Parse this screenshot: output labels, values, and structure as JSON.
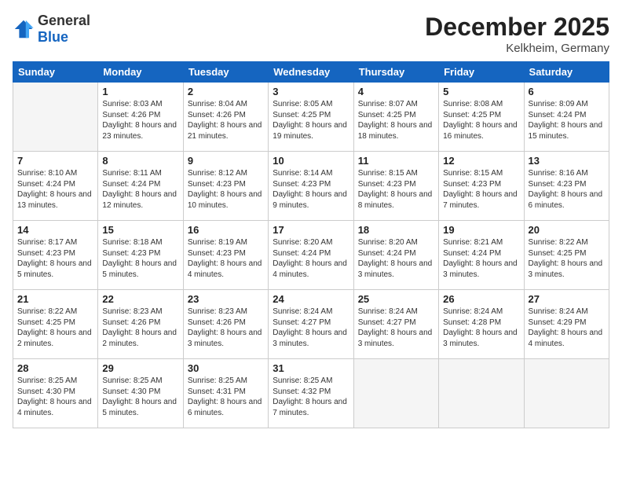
{
  "header": {
    "logo_general": "General",
    "logo_blue": "Blue",
    "month_title": "December 2025",
    "location": "Kelkheim, Germany"
  },
  "weekdays": [
    "Sunday",
    "Monday",
    "Tuesday",
    "Wednesday",
    "Thursday",
    "Friday",
    "Saturday"
  ],
  "weeks": [
    [
      {
        "day": "",
        "empty": true
      },
      {
        "day": "1",
        "sunrise": "Sunrise: 8:03 AM",
        "sunset": "Sunset: 4:26 PM",
        "daylight": "Daylight: 8 hours and 23 minutes."
      },
      {
        "day": "2",
        "sunrise": "Sunrise: 8:04 AM",
        "sunset": "Sunset: 4:26 PM",
        "daylight": "Daylight: 8 hours and 21 minutes."
      },
      {
        "day": "3",
        "sunrise": "Sunrise: 8:05 AM",
        "sunset": "Sunset: 4:25 PM",
        "daylight": "Daylight: 8 hours and 19 minutes."
      },
      {
        "day": "4",
        "sunrise": "Sunrise: 8:07 AM",
        "sunset": "Sunset: 4:25 PM",
        "daylight": "Daylight: 8 hours and 18 minutes."
      },
      {
        "day": "5",
        "sunrise": "Sunrise: 8:08 AM",
        "sunset": "Sunset: 4:25 PM",
        "daylight": "Daylight: 8 hours and 16 minutes."
      },
      {
        "day": "6",
        "sunrise": "Sunrise: 8:09 AM",
        "sunset": "Sunset: 4:24 PM",
        "daylight": "Daylight: 8 hours and 15 minutes."
      }
    ],
    [
      {
        "day": "7",
        "sunrise": "Sunrise: 8:10 AM",
        "sunset": "Sunset: 4:24 PM",
        "daylight": "Daylight: 8 hours and 13 minutes."
      },
      {
        "day": "8",
        "sunrise": "Sunrise: 8:11 AM",
        "sunset": "Sunset: 4:24 PM",
        "daylight": "Daylight: 8 hours and 12 minutes."
      },
      {
        "day": "9",
        "sunrise": "Sunrise: 8:12 AM",
        "sunset": "Sunset: 4:23 PM",
        "daylight": "Daylight: 8 hours and 10 minutes."
      },
      {
        "day": "10",
        "sunrise": "Sunrise: 8:14 AM",
        "sunset": "Sunset: 4:23 PM",
        "daylight": "Daylight: 8 hours and 9 minutes."
      },
      {
        "day": "11",
        "sunrise": "Sunrise: 8:15 AM",
        "sunset": "Sunset: 4:23 PM",
        "daylight": "Daylight: 8 hours and 8 minutes."
      },
      {
        "day": "12",
        "sunrise": "Sunrise: 8:15 AM",
        "sunset": "Sunset: 4:23 PM",
        "daylight": "Daylight: 8 hours and 7 minutes."
      },
      {
        "day": "13",
        "sunrise": "Sunrise: 8:16 AM",
        "sunset": "Sunset: 4:23 PM",
        "daylight": "Daylight: 8 hours and 6 minutes."
      }
    ],
    [
      {
        "day": "14",
        "sunrise": "Sunrise: 8:17 AM",
        "sunset": "Sunset: 4:23 PM",
        "daylight": "Daylight: 8 hours and 5 minutes."
      },
      {
        "day": "15",
        "sunrise": "Sunrise: 8:18 AM",
        "sunset": "Sunset: 4:23 PM",
        "daylight": "Daylight: 8 hours and 5 minutes."
      },
      {
        "day": "16",
        "sunrise": "Sunrise: 8:19 AM",
        "sunset": "Sunset: 4:23 PM",
        "daylight": "Daylight: 8 hours and 4 minutes."
      },
      {
        "day": "17",
        "sunrise": "Sunrise: 8:20 AM",
        "sunset": "Sunset: 4:24 PM",
        "daylight": "Daylight: 8 hours and 4 minutes."
      },
      {
        "day": "18",
        "sunrise": "Sunrise: 8:20 AM",
        "sunset": "Sunset: 4:24 PM",
        "daylight": "Daylight: 8 hours and 3 minutes."
      },
      {
        "day": "19",
        "sunrise": "Sunrise: 8:21 AM",
        "sunset": "Sunset: 4:24 PM",
        "daylight": "Daylight: 8 hours and 3 minutes."
      },
      {
        "day": "20",
        "sunrise": "Sunrise: 8:22 AM",
        "sunset": "Sunset: 4:25 PM",
        "daylight": "Daylight: 8 hours and 3 minutes."
      }
    ],
    [
      {
        "day": "21",
        "sunrise": "Sunrise: 8:22 AM",
        "sunset": "Sunset: 4:25 PM",
        "daylight": "Daylight: 8 hours and 2 minutes."
      },
      {
        "day": "22",
        "sunrise": "Sunrise: 8:23 AM",
        "sunset": "Sunset: 4:26 PM",
        "daylight": "Daylight: 8 hours and 2 minutes."
      },
      {
        "day": "23",
        "sunrise": "Sunrise: 8:23 AM",
        "sunset": "Sunset: 4:26 PM",
        "daylight": "Daylight: 8 hours and 3 minutes."
      },
      {
        "day": "24",
        "sunrise": "Sunrise: 8:24 AM",
        "sunset": "Sunset: 4:27 PM",
        "daylight": "Daylight: 8 hours and 3 minutes."
      },
      {
        "day": "25",
        "sunrise": "Sunrise: 8:24 AM",
        "sunset": "Sunset: 4:27 PM",
        "daylight": "Daylight: 8 hours and 3 minutes."
      },
      {
        "day": "26",
        "sunrise": "Sunrise: 8:24 AM",
        "sunset": "Sunset: 4:28 PM",
        "daylight": "Daylight: 8 hours and 3 minutes."
      },
      {
        "day": "27",
        "sunrise": "Sunrise: 8:24 AM",
        "sunset": "Sunset: 4:29 PM",
        "daylight": "Daylight: 8 hours and 4 minutes."
      }
    ],
    [
      {
        "day": "28",
        "sunrise": "Sunrise: 8:25 AM",
        "sunset": "Sunset: 4:30 PM",
        "daylight": "Daylight: 8 hours and 4 minutes."
      },
      {
        "day": "29",
        "sunrise": "Sunrise: 8:25 AM",
        "sunset": "Sunset: 4:30 PM",
        "daylight": "Daylight: 8 hours and 5 minutes."
      },
      {
        "day": "30",
        "sunrise": "Sunrise: 8:25 AM",
        "sunset": "Sunset: 4:31 PM",
        "daylight": "Daylight: 8 hours and 6 minutes."
      },
      {
        "day": "31",
        "sunrise": "Sunrise: 8:25 AM",
        "sunset": "Sunset: 4:32 PM",
        "daylight": "Daylight: 8 hours and 7 minutes."
      },
      {
        "day": "",
        "empty": true
      },
      {
        "day": "",
        "empty": true
      },
      {
        "day": "",
        "empty": true
      }
    ]
  ]
}
